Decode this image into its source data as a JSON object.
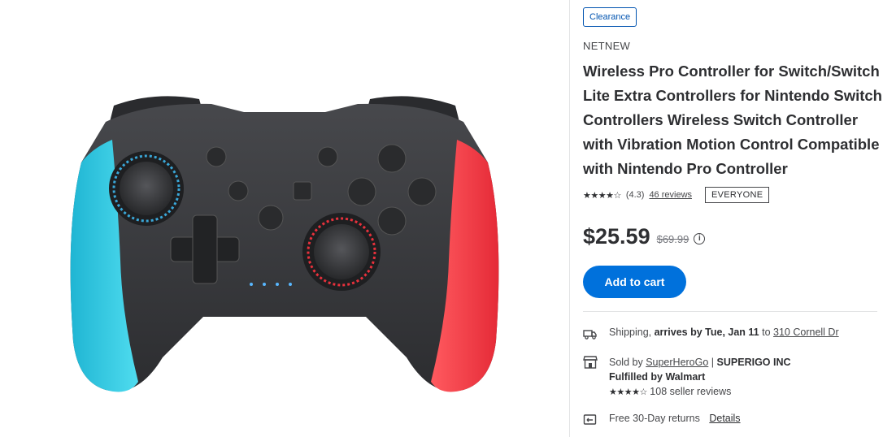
{
  "product_image": {
    "alt": "Wireless Pro Controller (blue and red grips)"
  },
  "badge": {
    "label": "Clearance"
  },
  "brand": "NETNEW",
  "title": "Wireless Pro Controller for Switch/Switch Lite Extra Controllers for Nintendo Switch Controllers Wireless Switch Controller with Vibration Motion Control Compatible with Nintendo Pro Controller",
  "rating": {
    "stars_text": "★★★★☆",
    "value": "(4.3)",
    "reviews_link": "46 reviews",
    "age_rating": "EVERYONE"
  },
  "price": {
    "current": "$25.59",
    "was": "$69.99",
    "info_icon": "i"
  },
  "cart": {
    "add_label": "Add to cart"
  },
  "shipping": {
    "icon": "truck-icon",
    "label": "Shipping,",
    "arrives": "arrives by Tue, Jan 11",
    "to": "to",
    "address": "310 Cornell Dr"
  },
  "seller": {
    "icon": "store-icon",
    "sold_by": "Sold by",
    "seller_name": "SuperHeroGo",
    "separator": "|",
    "company": "SUPERIGO INC",
    "fulfilled": "Fulfilled by Walmart",
    "stars_text": "★★★★☆",
    "reviews": "108 seller reviews"
  },
  "returns": {
    "icon": "returns-icon",
    "label": "Free 30-Day returns",
    "details_link": "Details"
  },
  "colors": {
    "accent_blue": "#0071dc",
    "grip_left": "#2fd0e8",
    "grip_right": "#ff3b47",
    "body": "#3a3b3e"
  }
}
